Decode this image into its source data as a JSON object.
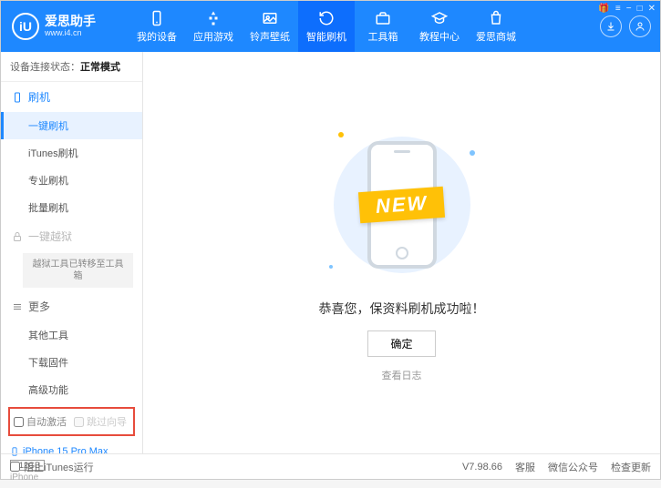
{
  "logo": {
    "icon_text": "iU",
    "title": "爱思助手",
    "url": "www.i4.cn"
  },
  "titlebar": {
    "gift": "🎁",
    "menu": "≡",
    "min": "−",
    "max": "□",
    "close": "✕"
  },
  "nav": [
    {
      "key": "device",
      "label": "我的设备"
    },
    {
      "key": "apps",
      "label": "应用游戏"
    },
    {
      "key": "ring",
      "label": "铃声壁纸"
    },
    {
      "key": "flash",
      "label": "智能刷机"
    },
    {
      "key": "tools",
      "label": "工具箱"
    },
    {
      "key": "tutorial",
      "label": "教程中心"
    },
    {
      "key": "mall",
      "label": "爱思商城"
    }
  ],
  "conn": {
    "prefix": "设备连接状态：",
    "status": "正常模式"
  },
  "sidebar": {
    "flash_group": "刷机",
    "one_key": "一键刷机",
    "itunes": "iTunes刷机",
    "pro": "专业刷机",
    "batch": "批量刷机",
    "jailbreak_group": "一键越狱",
    "jailbreak_note": "越狱工具已转移至工具箱",
    "more_group": "更多",
    "other_tools": "其他工具",
    "download_fw": "下载固件",
    "advanced": "高级功能",
    "auto_activate": "自动激活",
    "skip_guide": "跳过向导"
  },
  "device": {
    "name": "iPhone 15 Pro Max",
    "storage": "512GB",
    "type": "iPhone"
  },
  "main": {
    "new_badge": "NEW",
    "message": "恭喜您，保资料刷机成功啦！",
    "ok": "确定",
    "view_log": "查看日志"
  },
  "footer": {
    "block_itunes": "阻止iTunes运行",
    "version": "V7.98.66",
    "support": "客服",
    "wechat": "微信公众号",
    "update": "检查更新"
  }
}
